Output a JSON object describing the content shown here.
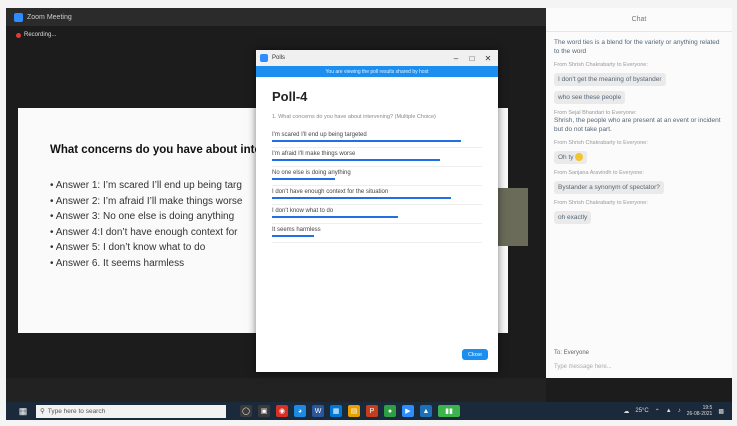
{
  "zoom": {
    "window_title": "Zoom Meeting",
    "recording_label": "Recording..."
  },
  "slide": {
    "title": "What concerns do you have about interve",
    "answers": [
      "• Answer 1: I’m scared I’ll end up being targ",
      "• Answer 2: I’m afraid I’ll make things worse",
      "• Answer 3: No one else is doing anything",
      "• Answer 4:I don’t have enough context for",
      "• Answer 5: I don’t know what to do",
      "• Answer 6. It seems harmless"
    ]
  },
  "poll": {
    "window_title": "Polls",
    "banner": "You are viewing the poll results shared by host",
    "heading": "Poll-4",
    "question": "1. What concerns do you have about intervening? (Multiple Choice)",
    "options": [
      {
        "label": "I'm scared I'll end up being targeted",
        "bar": 0.9
      },
      {
        "label": "I'm afraid I'll make things worse",
        "bar": 0.8
      },
      {
        "label": "No one else is doing anything",
        "bar": 0.3
      },
      {
        "label": "I don't have enough context for the situation",
        "bar": 0.85
      },
      {
        "label": "I don't know what to do",
        "bar": 0.6
      },
      {
        "label": "It seems harmless",
        "bar": 0.2
      }
    ],
    "close_label": "Close"
  },
  "chat": {
    "title": "Chat",
    "messages": [
      {
        "from": "",
        "text": "The word ties is a blend for the variety or anything related to the word"
      },
      {
        "from": "From Shrish Chakrabarty to Everyone:",
        "text": "I don't get the meaning of bystander"
      },
      {
        "from": "",
        "text": "who see these people"
      },
      {
        "from": "From Sejal Bhandari to Everyone:",
        "text": "Shrish, the people who are present at an event or incident but do not take part."
      },
      {
        "from": "From Shrish Chakrabarty to Everyone:",
        "text": "Oh ty"
      },
      {
        "from": "From Sanjana Aravindh to Everyone:",
        "text": "Bystander a synonym of spectator?"
      },
      {
        "from": "From Shrish Chakrabarty to Everyone:",
        "text": "oh exactly"
      }
    ],
    "to_label": "To: Everyone",
    "input_placeholder": "Type message here..."
  },
  "taskbar": {
    "search_placeholder": "Type here to search",
    "weather": "25°C",
    "time": "19:5",
    "date": "26-08-2021"
  }
}
